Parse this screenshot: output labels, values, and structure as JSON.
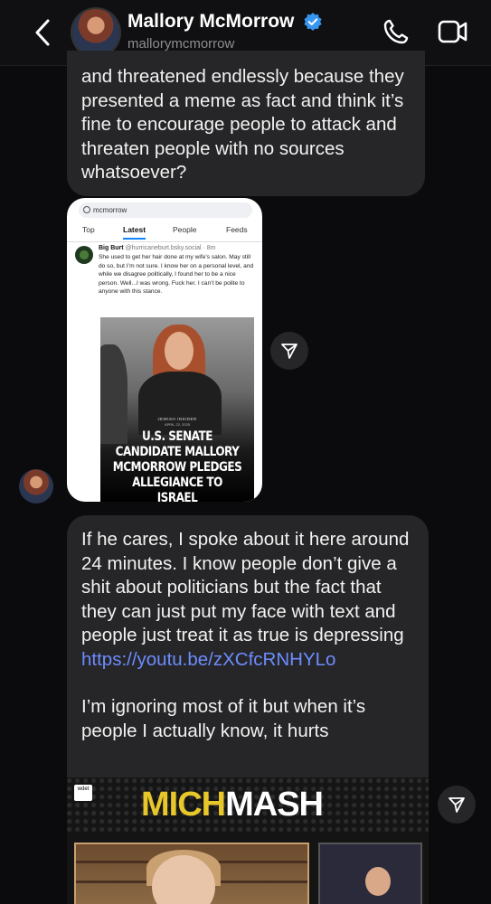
{
  "header": {
    "name": "Mallory McMorrow",
    "handle": "mallorymcmorrow"
  },
  "messages": {
    "m1_text": "and threatened endlessly because they presented a meme as fact and think it’s fine to encourage people to attack and threaten people with no sources whatsoever?",
    "shared_post": {
      "search_query": "mcmorrow",
      "tabs": [
        "Top",
        "Latest",
        "People",
        "Feeds"
      ],
      "active_tab": "Latest",
      "author_name": "Big Burt",
      "author_meta": "@hurricaneburt.bsky.social · 8m",
      "post_text": "She used to get her hair done at my wife’s salon. May still do so, but I’m not sure. I know her on a personal level, and while we disagree politically, I found her to be a nice person. Well...I was wrong. Fuck her. I can’t be polite to anyone with this stance.",
      "image_source": "JEWISH INSIDER",
      "image_date": "APRIL 22, 2025",
      "image_headline": "U.S. SENATE CANDIDATE MALLORY MCMORROW PLEDGES ALLEGIANCE TO ISRAEL"
    },
    "m2_text_a": "If he cares, I spoke about it here around 24 minutes. I know people don’t give a shit about politicians but the fact that they can just put my face with text and people just treat it as true is depressing ",
    "m2_link": "https://youtu.be/zXCfcRNHYLo",
    "m2_text_b": "I’m ignoring most of it but when it’s people I actually know, it hurts",
    "video_card": {
      "badge": "wdet",
      "title_part1": "MICH",
      "title_part2": "MASH"
    }
  }
}
